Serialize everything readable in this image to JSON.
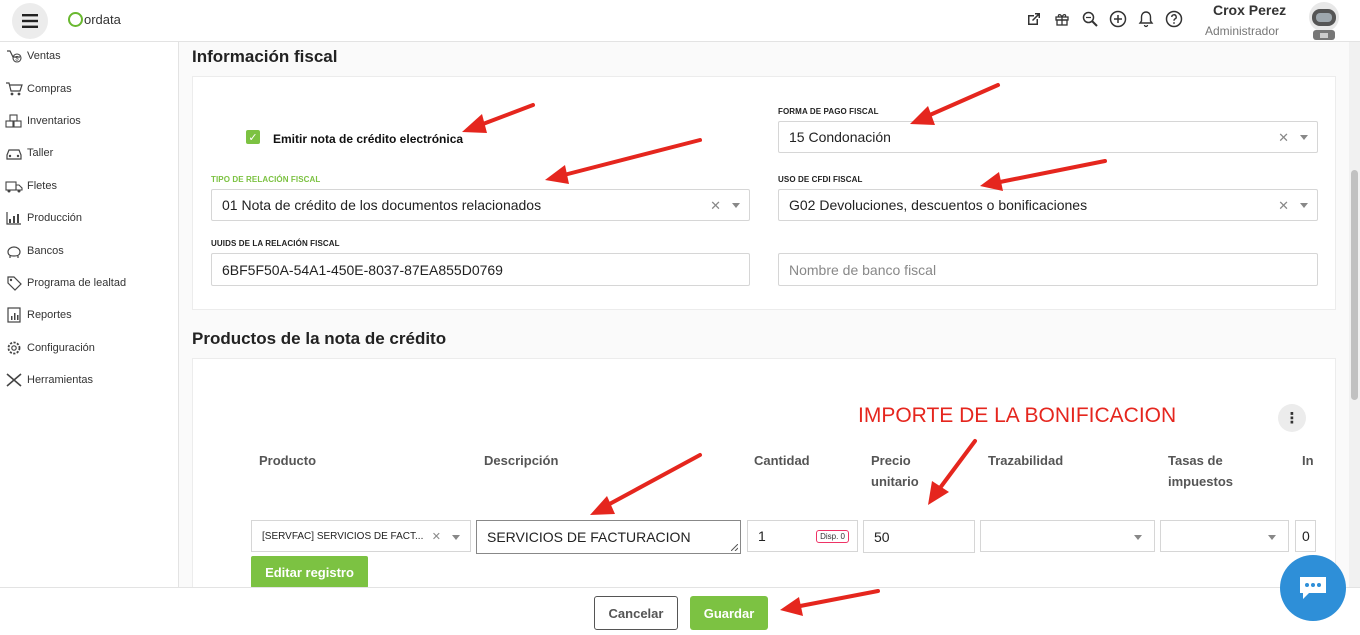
{
  "header": {
    "logo_text": "ordata",
    "user_name": "Crox Perez",
    "user_role": "Administrador"
  },
  "sidebar": {
    "items": [
      {
        "label": "Ventas",
        "icon": "sales-icon"
      },
      {
        "label": "Compras",
        "icon": "cart-icon"
      },
      {
        "label": "Inventarios",
        "icon": "boxes-icon"
      },
      {
        "label": "Taller",
        "icon": "car-icon"
      },
      {
        "label": "Fletes",
        "icon": "truck-icon"
      },
      {
        "label": "Producción",
        "icon": "chart-icon"
      },
      {
        "label": "Bancos",
        "icon": "bank-icon"
      },
      {
        "label": "Programa de lealtad",
        "icon": "tag-icon"
      },
      {
        "label": "Reportes",
        "icon": "report-icon"
      },
      {
        "label": "Configuración",
        "icon": "gear-icon"
      },
      {
        "label": "Herramientas",
        "icon": "tools-icon"
      }
    ]
  },
  "fiscal": {
    "title": "Información fiscal",
    "emit_label": "Emitir nota de crédito electrónica",
    "forma_pago_label": "FORMA DE PAGO FISCAL",
    "forma_pago_value": "15 Condonación",
    "tipo_relacion_label": "TIPO DE RELACIÓN FISCAL",
    "tipo_relacion_value": "01 Nota de crédito de los documentos relacionados",
    "uso_cfdi_label": "USO DE CFDI FISCAL",
    "uso_cfdi_value": "G02 Devoluciones, descuentos o bonificaciones",
    "uuids_label": "UUIDS DE LA RELACIÓN FISCAL",
    "uuids_value": "6BF5F50A-54A1-450E-8037-87EA855D0769",
    "banco_placeholder": "Nombre de banco fiscal"
  },
  "products": {
    "title": "Productos de la nota de crédito",
    "annotation": "IMPORTE DE LA BONIFICACION",
    "col_producto": "Producto",
    "col_descripcion": "Descripción",
    "col_cantidad": "Cantidad",
    "col_precio_1": "Precio",
    "col_precio_2": "unitario",
    "col_trazabilidad": "Trazabilidad",
    "col_tasas_1": "Tasas de",
    "col_tasas_2": "impuestos",
    "col_importe_trunc": "In",
    "row": {
      "producto": "[SERVFAC] SERVICIOS DE FACT...",
      "descripcion": "SERVICIOS DE FACTURACION",
      "cantidad": "1",
      "disp": "Disp. 0",
      "precio": "50",
      "importe_trunc": "0"
    },
    "edit_button": "Editar registro"
  },
  "footer": {
    "cancel": "Cancelar",
    "save": "Guardar"
  }
}
